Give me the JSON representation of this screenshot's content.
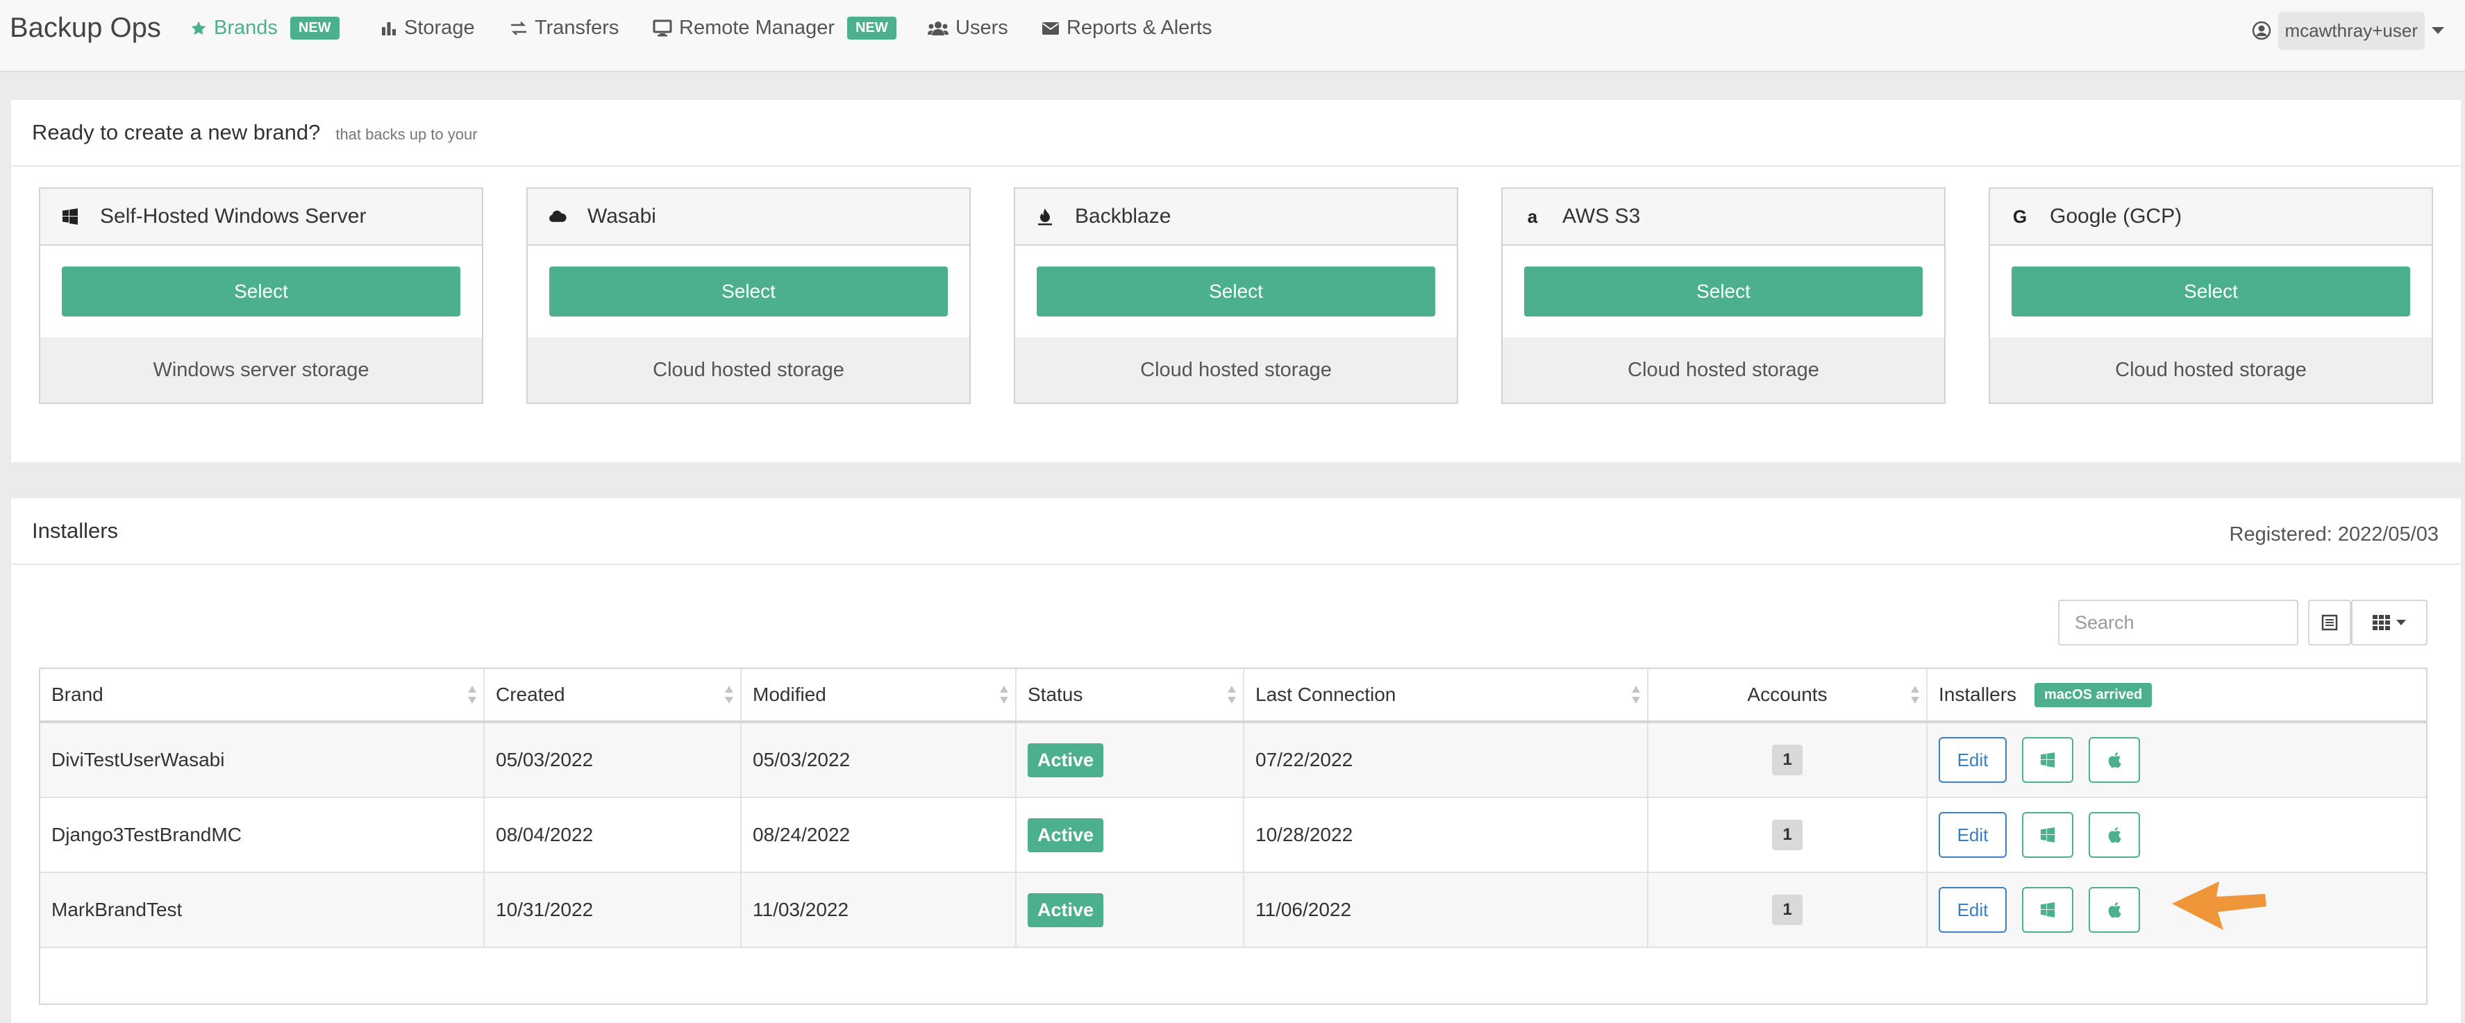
{
  "app": {
    "title": "Backup Ops"
  },
  "nav": {
    "items": [
      {
        "label": "Brands",
        "badge": "NEW",
        "active": true,
        "icon": "star-icon"
      },
      {
        "label": "Storage",
        "icon": "bar-chart-icon"
      },
      {
        "label": "Transfers",
        "icon": "transfer-arrows-icon"
      },
      {
        "label": "Remote Manager",
        "badge": "NEW",
        "icon": "monitor-icon"
      },
      {
        "label": "Users",
        "icon": "users-icon"
      },
      {
        "label": "Reports & Alerts",
        "icon": "envelope-icon"
      }
    ],
    "user": "mcawthray+user"
  },
  "brand_panel": {
    "title": "Ready to create a new brand?",
    "subtitle": "that backs up to your",
    "cards": [
      {
        "name": "Self-Hosted Windows Server",
        "icon": "windows-icon",
        "button": "Select",
        "footer": "Windows server storage"
      },
      {
        "name": "Wasabi",
        "icon": "cloud-icon",
        "button": "Select",
        "footer": "Cloud hosted storage"
      },
      {
        "name": "Backblaze",
        "icon": "flame-icon",
        "button": "Select",
        "footer": "Cloud hosted storage"
      },
      {
        "name": "AWS S3",
        "icon": "amazon-icon",
        "button": "Select",
        "footer": "Cloud hosted storage"
      },
      {
        "name": "Google (GCP)",
        "icon": "google-icon",
        "button": "Select",
        "footer": "Cloud hosted storage"
      }
    ]
  },
  "installers_panel": {
    "title": "Installers",
    "registered": "Registered: 2022/05/03",
    "search_placeholder": "Search",
    "columns": [
      "Brand",
      "Created",
      "Modified",
      "Status",
      "Last Connection",
      "Accounts",
      "Installers"
    ],
    "installers_badge": "macOS arrived",
    "edit_label": "Edit",
    "rows": [
      {
        "brand": "DiviTestUserWasabi",
        "created": "05/03/2022",
        "modified": "05/03/2022",
        "status": "Active",
        "last_connection": "07/22/2022",
        "accounts": "1"
      },
      {
        "brand": "Django3TestBrandMC",
        "created": "08/04/2022",
        "modified": "08/24/2022",
        "status": "Active",
        "last_connection": "10/28/2022",
        "accounts": "1"
      },
      {
        "brand": "MarkBrandTest",
        "created": "10/31/2022",
        "modified": "11/03/2022",
        "status": "Active",
        "last_connection": "11/06/2022",
        "accounts": "1"
      }
    ]
  },
  "colors": {
    "accent": "#4caf8d",
    "edit_blue": "#3a7fc0",
    "arrow": "#f0963a"
  }
}
